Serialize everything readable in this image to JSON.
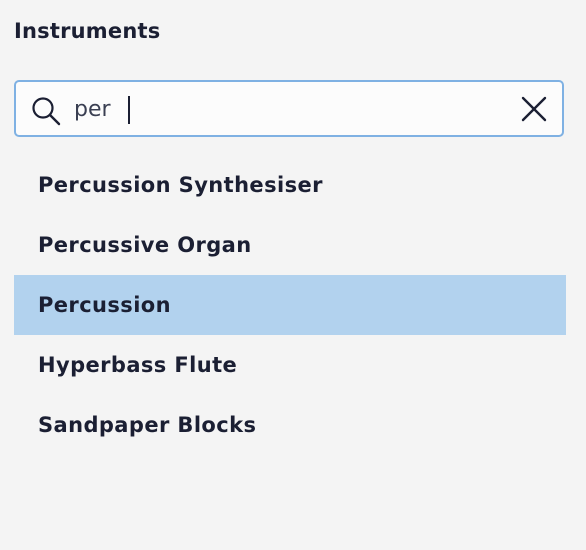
{
  "panel": {
    "title": "Instruments"
  },
  "search": {
    "value": "per",
    "icon": "search-icon",
    "clear_icon": "close-icon"
  },
  "results": [
    {
      "label": "Percussion Synthesiser",
      "selected": false
    },
    {
      "label": "Percussive Organ",
      "selected": false
    },
    {
      "label": "Percussion",
      "selected": true
    },
    {
      "label": "Hyperbass Flute",
      "selected": false
    },
    {
      "label": "Sandpaper Blocks",
      "selected": false
    }
  ],
  "colors": {
    "background": "#f4f4f4",
    "text": "#1b1f33",
    "selection": "#b2d2ee",
    "focus_border": "#7fb1e3"
  }
}
